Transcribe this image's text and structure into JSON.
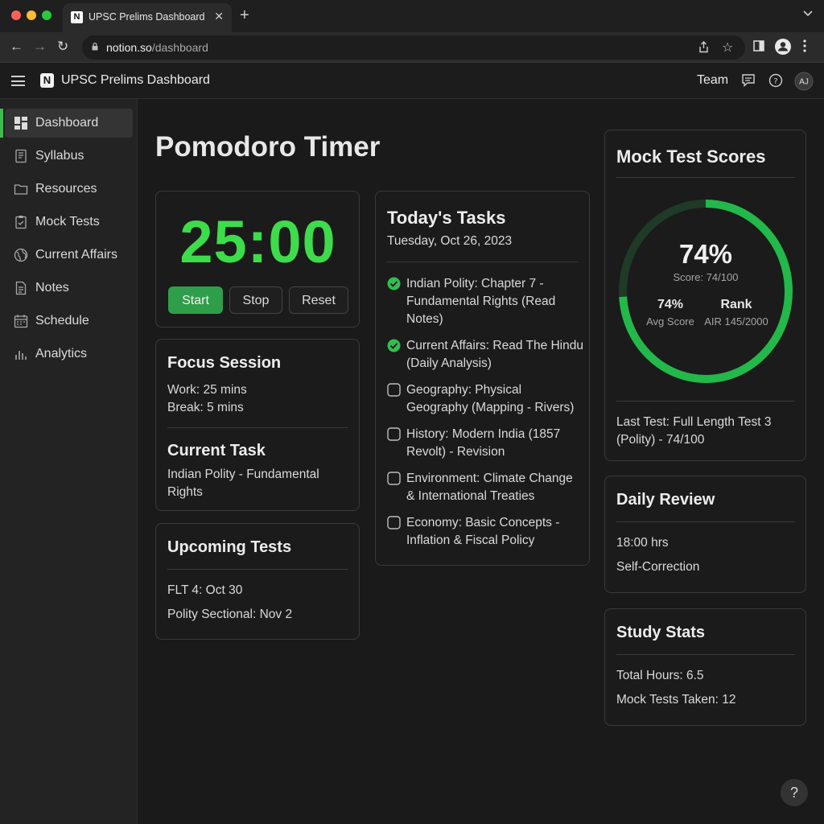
{
  "browser": {
    "tab_title": "UPSC Prelims Dashboard",
    "tab_favicon": "N",
    "url_host": "notion.so",
    "url_path": "/dashboard"
  },
  "app": {
    "title": "UPSC Prelims Dashboard",
    "logo": "N",
    "team_label": "Team",
    "avatar_initials": "AJ"
  },
  "sidebar": {
    "items": [
      {
        "label": "Dashboard",
        "icon": "grid-icon",
        "active": true
      },
      {
        "label": "Syllabus",
        "icon": "book-icon"
      },
      {
        "label": "Resources",
        "icon": "folder-icon"
      },
      {
        "label": "Mock Tests",
        "icon": "clipboard-icon"
      },
      {
        "label": "Current Affairs",
        "icon": "globe-icon"
      },
      {
        "label": "Notes",
        "icon": "document-icon"
      },
      {
        "label": "Schedule",
        "icon": "calendar-icon"
      },
      {
        "label": "Analytics",
        "icon": "bar-chart-icon"
      }
    ]
  },
  "page": {
    "title": "Pomodoro Timer"
  },
  "timer": {
    "display": "25:00",
    "start_label": "Start",
    "stop_label": "Stop",
    "reset_label": "Reset"
  },
  "focus": {
    "title": "Focus Session",
    "work": "Work: 25 mins",
    "break": "Break: 5 mins",
    "current_task_title": "Current Task",
    "current_task": "Indian Polity - Fundamental Rights"
  },
  "upcoming": {
    "title": "Upcoming Tests",
    "items": [
      "FLT 4: Oct 30",
      "Polity Sectional: Nov 2"
    ]
  },
  "tasks": {
    "title": "Today's Tasks",
    "date": "Tuesday, Oct 26, 2023",
    "items": [
      {
        "text": "Indian Polity: Chapter 7 - Fundamental Rights (Read Notes)",
        "done": true
      },
      {
        "text": "Current Affairs: Read The Hindu (Daily Analysis)",
        "done": true
      },
      {
        "text": "Geography: Physical Geography (Mapping - Rivers)",
        "done": false
      },
      {
        "text": "History: Modern India (1857 Revolt) - Revision",
        "done": false
      },
      {
        "text": "Environment: Climate Change & International Treaties",
        "done": false
      },
      {
        "text": "Economy: Basic Concepts - Inflation & Fiscal Policy",
        "done": false
      }
    ]
  },
  "mock": {
    "title": "Mock Test Scores",
    "score_pct": "74%",
    "score_label": "Score: 74/100",
    "score_fraction": 0.74,
    "avg_value": "74%",
    "avg_label": "Avg Score",
    "rank_value": "Rank",
    "rank_label": "AIR 145/2000",
    "last_test": "Last Test: Full Length Test 3 (Polity) - 74/100"
  },
  "review": {
    "title": "Daily Review",
    "time": "18:00 hrs",
    "note": "Self-Correction"
  },
  "stats": {
    "title": "Study Stats",
    "hours": "Total Hours: 6.5",
    "mocks": "Mock Tests Taken: 12"
  },
  "help": {
    "label": "?"
  },
  "colors": {
    "accent_green": "#3ddc4a",
    "button_green": "#2f9e4a",
    "ring_green": "#22b84a",
    "ring_track": "#1f3a26"
  }
}
